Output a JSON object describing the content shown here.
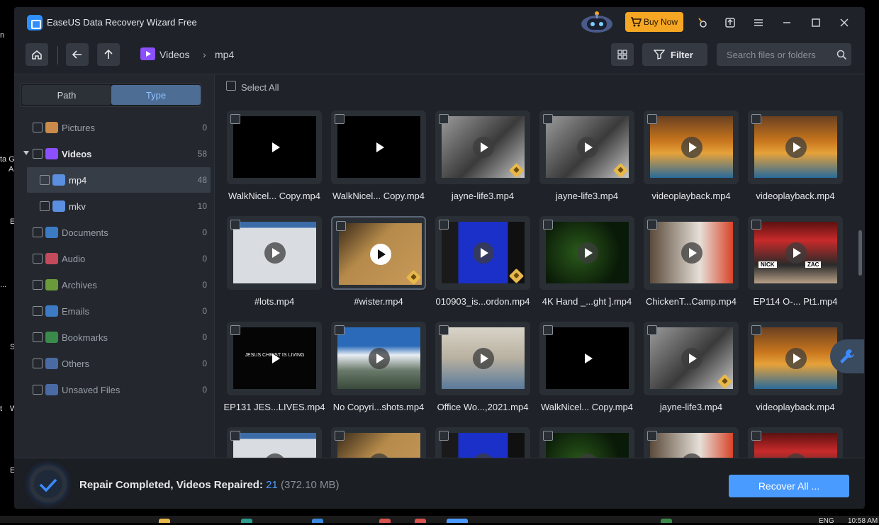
{
  "desktop": {
    "left_fragments": [
      "n",
      "ta G",
      "A",
      "E",
      "...",
      "S",
      "t",
      "W",
      "E"
    ],
    "tray": {
      "lang": "ENG",
      "time": "10:58 AM"
    }
  },
  "titlebar": {
    "app_title": "EaseUS Data Recovery Wizard Free",
    "buy_label": "Buy Now",
    "accent": "#f5a623"
  },
  "toolbar": {
    "breadcrumb": [
      "Videos",
      "mp4"
    ],
    "filter_label": "Filter",
    "search_placeholder": "Search files or folders"
  },
  "sidebar": {
    "tabs": [
      "Path",
      "Type"
    ],
    "active_tab": "Type",
    "categories": [
      {
        "label": "Pictures",
        "count": "0",
        "icon": "pictures-icon",
        "color": "#c98a4a"
      },
      {
        "label": "Videos",
        "count": "58",
        "icon": "videos-icon",
        "color": "#8c4fff"
      },
      {
        "label": "mp4",
        "count": "48",
        "icon": "folder-icon",
        "color": "#5b8fe0"
      },
      {
        "label": "mkv",
        "count": "10",
        "icon": "folder-icon",
        "color": "#5b8fe0"
      },
      {
        "label": "Documents",
        "count": "0",
        "icon": "documents-icon",
        "color": "#3c7ac4"
      },
      {
        "label": "Audio",
        "count": "0",
        "icon": "audio-icon",
        "color": "#c24a5a"
      },
      {
        "label": "Archives",
        "count": "0",
        "icon": "archives-icon",
        "color": "#6a9a3a"
      },
      {
        "label": "Emails",
        "count": "0",
        "icon": "emails-icon",
        "color": "#3c7ac4"
      },
      {
        "label": "Bookmarks",
        "count": "0",
        "icon": "bookmarks-icon",
        "color": "#3a8a4a"
      },
      {
        "label": "Others",
        "count": "0",
        "icon": "others-icon",
        "color": "#4a6aa4"
      },
      {
        "label": "Unsaved Files",
        "count": "0",
        "icon": "unsaved-files-icon",
        "color": "#4a6aa4"
      }
    ]
  },
  "main": {
    "select_all_label": "Select All",
    "files": [
      {
        "name": "WalkNicel... Copy.mp4",
        "thumb": "black",
        "badge": false
      },
      {
        "name": "WalkNicel... Copy.mp4",
        "thumb": "black",
        "badge": false
      },
      {
        "name": "jayne-life3.mp4",
        "thumb": "gray",
        "badge": true
      },
      {
        "name": "jayne-life3.mp4",
        "thumb": "gray",
        "badge": true
      },
      {
        "name": "videoplayback.mp4",
        "thumb": "game",
        "badge": false
      },
      {
        "name": "videoplayback.mp4",
        "thumb": "game",
        "badge": false
      },
      {
        "name": "#lots.mp4",
        "thumb": "software",
        "badge": false
      },
      {
        "name": "#wister.mp4",
        "thumb": "table",
        "badge": true
      },
      {
        "name": "010903_is...ordon.mp4",
        "thumb": "stage",
        "badge": true
      },
      {
        "name": "4K Hand _...ght ].mp4",
        "thumb": "leaves",
        "badge": false
      },
      {
        "name": "ChickenT...Camp.mp4",
        "thumb": "chicken",
        "badge": false
      },
      {
        "name": "EP114 O-... Pt1.mp4",
        "thumb": "crowd",
        "badge": false
      },
      {
        "name": "EP131 JES...LIVES.mp4",
        "thumb": "text",
        "badge": false
      },
      {
        "name": "No Copyri...shots.mp4",
        "thumb": "mountain",
        "badge": false
      },
      {
        "name": "Office Wo...,2021.mp4",
        "thumb": "office",
        "badge": false
      },
      {
        "name": "WalkNicel... Copy.mp4",
        "thumb": "black",
        "badge": false
      },
      {
        "name": "jayne-life3.mp4",
        "thumb": "gray",
        "badge": true
      },
      {
        "name": "videoplayback.mp4",
        "thumb": "game",
        "badge": false
      },
      {
        "name": "",
        "thumb": "software",
        "badge": false
      },
      {
        "name": "",
        "thumb": "table",
        "badge": false
      },
      {
        "name": "",
        "thumb": "stage",
        "badge": false
      },
      {
        "name": "",
        "thumb": "leaves",
        "badge": false
      },
      {
        "name": "",
        "thumb": "chicken",
        "badge": false
      },
      {
        "name": "",
        "thumb": "crowd",
        "badge": false
      }
    ],
    "thumb_texts": {
      "text": "JESUS CHRIST IS LIVING",
      "crowd_left": "NICK",
      "crowd_right": "ZAC"
    }
  },
  "footer": {
    "status_label": "Repair Completed, Videos Repaired:",
    "repaired_count": "21",
    "repaired_size": "(372.10 MB)",
    "recover_label": "Recover All ..."
  }
}
